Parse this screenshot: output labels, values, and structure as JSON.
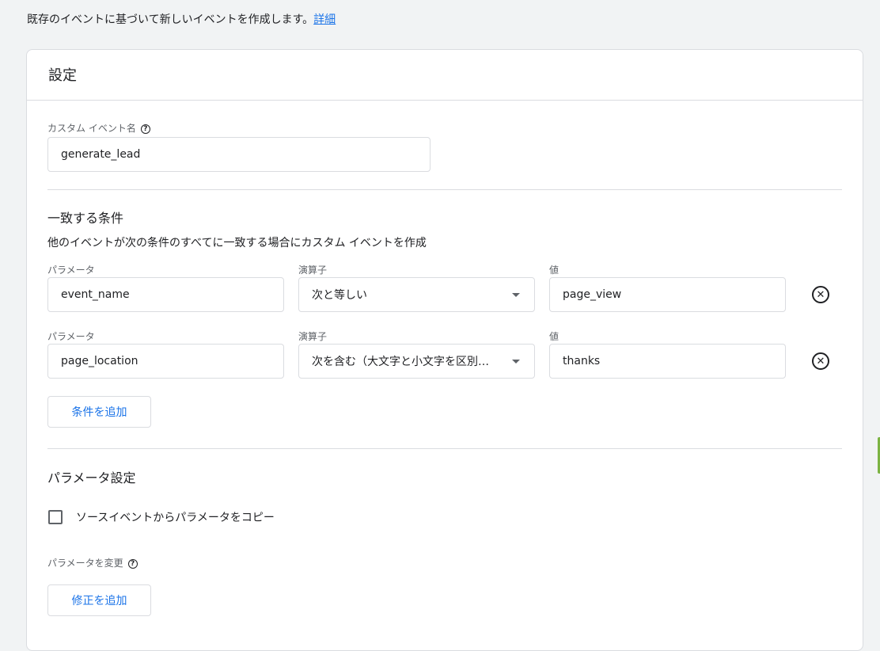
{
  "intro": {
    "text": "既存のイベントに基づいて新しいイベントを作成します。",
    "link": "詳細"
  },
  "card": {
    "title": "設定",
    "event_name": {
      "label": "カスタム イベント名",
      "help_icon": "help-icon",
      "value": "generate_lead"
    },
    "conditions": {
      "title": "一致する条件",
      "description": "他のイベントが次の条件のすべてに一致する場合にカスタム イベントを作成",
      "rows": [
        {
          "param_label": "パラメータ",
          "param_value": "event_name",
          "operator_label": "演算子",
          "operator_value": "次と等しい",
          "value_label": "値",
          "value": "page_view"
        },
        {
          "param_label": "パラメータ",
          "param_value": "page_location",
          "operator_label": "演算子",
          "operator_value": "次を含む（大文字と小文字を区別…",
          "value_label": "値",
          "value": "thanks"
        }
      ],
      "add_button": "条件を追加",
      "remove_icon": "close-circle-icon"
    },
    "params": {
      "title": "パラメータ設定",
      "copy_checkbox_label": "ソースイベントからパラメータをコピー",
      "copy_checked": false,
      "modify_label": "パラメータを変更",
      "add_button": "修正を追加"
    }
  },
  "colors": {
    "accent": "#1a73e8",
    "side_tab": "#7cb342"
  }
}
